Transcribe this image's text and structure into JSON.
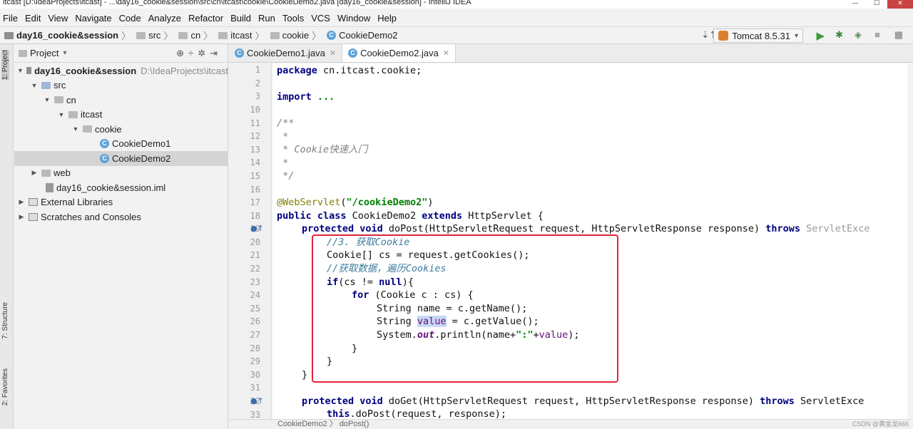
{
  "window": {
    "title": "itcast [D:\\IdeaProjects\\itcast] - ...\\day16_cookie&session\\src\\cn\\itcast\\cookie\\CookieDemo2.java [day16_cookie&session] - IntelliJ IDEA",
    "minimize": "—",
    "maximize": "☐",
    "close": "✕"
  },
  "menu": [
    "File",
    "Edit",
    "View",
    "Navigate",
    "Code",
    "Analyze",
    "Refactor",
    "Build",
    "Run",
    "Tools",
    "VCS",
    "Window",
    "Help"
  ],
  "breadcrumb": [
    "day16_cookie&session",
    "src",
    "cn",
    "itcast",
    "cookie",
    "CookieDemo2"
  ],
  "run_config": "Tomcat 8.5.31",
  "left_strip": {
    "project_tab": "1: Project",
    "structure_tab": "7: Structure",
    "favorites_tab": "2: Favorites"
  },
  "project_panel": {
    "title": "Project",
    "tree": [
      {
        "label": "day16_cookie&session",
        "path": "D:\\IdeaProjects\\itcast"
      },
      {
        "label": "src"
      },
      {
        "label": "cn"
      },
      {
        "label": "itcast"
      },
      {
        "label": "cookie"
      },
      {
        "label": "CookieDemo1"
      },
      {
        "label": "CookieDemo2"
      },
      {
        "label": "web"
      },
      {
        "label": "day16_cookie&session.iml"
      },
      {
        "label": "External Libraries"
      },
      {
        "label": "Scratches and Consoles"
      }
    ]
  },
  "editor": {
    "tabs": [
      "CookieDemo1.java",
      "CookieDemo2.java"
    ],
    "line_numbers": [
      "1",
      "2",
      "3",
      "10",
      "11",
      "12",
      "13",
      "14",
      "15",
      "16",
      "17",
      "18",
      "19",
      "20",
      "21",
      "22",
      "23",
      "24",
      "25",
      "26",
      "27",
      "28",
      "29",
      "30",
      "31",
      "32",
      "33"
    ],
    "code": {
      "l1_kw": "package",
      "l1_rest": " cn.itcast.cookie;",
      "l3_kw": "import",
      "l3_rest": " ...",
      "l11": "/**",
      "l12": " *",
      "l13": " * Cookie快速入门",
      "l14": " *",
      "l15": " */",
      "l17_ann": "@WebServlet",
      "l17_p1": "(",
      "l17_str": "\"/cookieDemo2\"",
      "l17_p2": ")",
      "l18_kw1": "public class",
      "l18_mid": " CookieDemo2 ",
      "l18_kw2": "extends",
      "l18_rest": " HttpServlet {",
      "l19_kw": "protected void",
      "l19_mid": " doPost(HttpServletRequest request, HttpServletResponse response) ",
      "l19_kw2": "throws",
      "l19_faint": " ServletExce",
      "l20": "//3. 获取Cookie",
      "l21": "Cookie[] cs = request.getCookies();",
      "l22": "//获取数据，遍历Cookies",
      "l23_kw": "if",
      "l23_a": "(cs != ",
      "l23_kw2": "null",
      "l23_b": "){",
      "l24_kw": "for",
      "l24_rest": " (Cookie c : cs) {",
      "l25": "String name = c.getName();",
      "l26_a": "String ",
      "l26_hl": "value",
      "l26_b": " = c.getValue();",
      "l27_a": "System.",
      "l27_out": "out",
      "l27_b": ".println(name+",
      "l27_str": "\":\"",
      "l27_c": "+",
      "l27_fld": "value",
      "l27_d": ");",
      "l28": "}",
      "l29": "}",
      "l30": "}",
      "l32_kw": "protected void",
      "l32_mid": " doGet(HttpServletRequest request, HttpServletResponse response) ",
      "l32_kw2": "throws",
      "l32_rest": " ServletExce",
      "l33_kw": "this",
      "l33_rest": ".doPost(request, response);"
    }
  },
  "status": {
    "breadcrumb": "CookieDemo2  〉 doPost()"
  },
  "watermark": "CSDN @黄金龙666",
  "colors": {
    "keyword": "#000080",
    "string": "#008000",
    "comment": "#808080",
    "annotation": "#808000",
    "highlight_box": "#e0243a"
  }
}
